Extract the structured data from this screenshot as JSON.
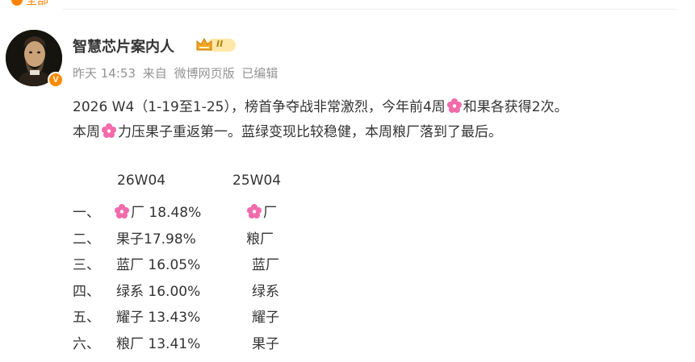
{
  "topbar": {
    "tab_label": "全部"
  },
  "post": {
    "author": {
      "name": "智慧芯片案内人",
      "verified_mark": "V",
      "level_badge": "II"
    },
    "meta": {
      "time": "昨天 14:53",
      "source_prefix": "来自",
      "source": "微博网页版",
      "edited": "已编辑"
    },
    "line1_a": "2026 W4（1-19至1-25），榜首争夺战非常激烈，今年前4周",
    "line1_b": "和果各获得2次。",
    "line2_a": "本周",
    "line2_b": "力压果子重返第一。蓝绿变现比较稳健，本周粮厂落到了最后。",
    "table": {
      "headers": [
        "26W04",
        "25W04"
      ],
      "rows": [
        {
          "rank": "一、",
          "cur": "厂 18.48%",
          "cur_flower": true,
          "prev": "厂",
          "prev_flower": true
        },
        {
          "rank": "二、",
          "cur": "果子17.98%",
          "cur_flower": false,
          "prev": "粮厂",
          "prev_flower": false
        },
        {
          "rank": "三、",
          "cur": "蓝厂 16.05%",
          "cur_flower": false,
          "prev": "蓝厂",
          "prev_flower": false
        },
        {
          "rank": "四、",
          "cur": "绿系 16.00%",
          "cur_flower": false,
          "prev": "绿系",
          "prev_flower": false
        },
        {
          "rank": "五、",
          "cur": "耀子 13.43%",
          "cur_flower": false,
          "prev": "耀子",
          "prev_flower": false
        },
        {
          "rank": "六、",
          "cur": "粮厂 13.41%",
          "cur_flower": false,
          "prev": "果子",
          "prev_flower": false
        }
      ]
    }
  },
  "colors": {
    "accent": "#ff8200",
    "text": "#333333",
    "meta": "#939393",
    "flower": "#f26bab"
  },
  "icons": {
    "flower": "pink-flower-emoji",
    "crown": "crown-level-badge"
  }
}
